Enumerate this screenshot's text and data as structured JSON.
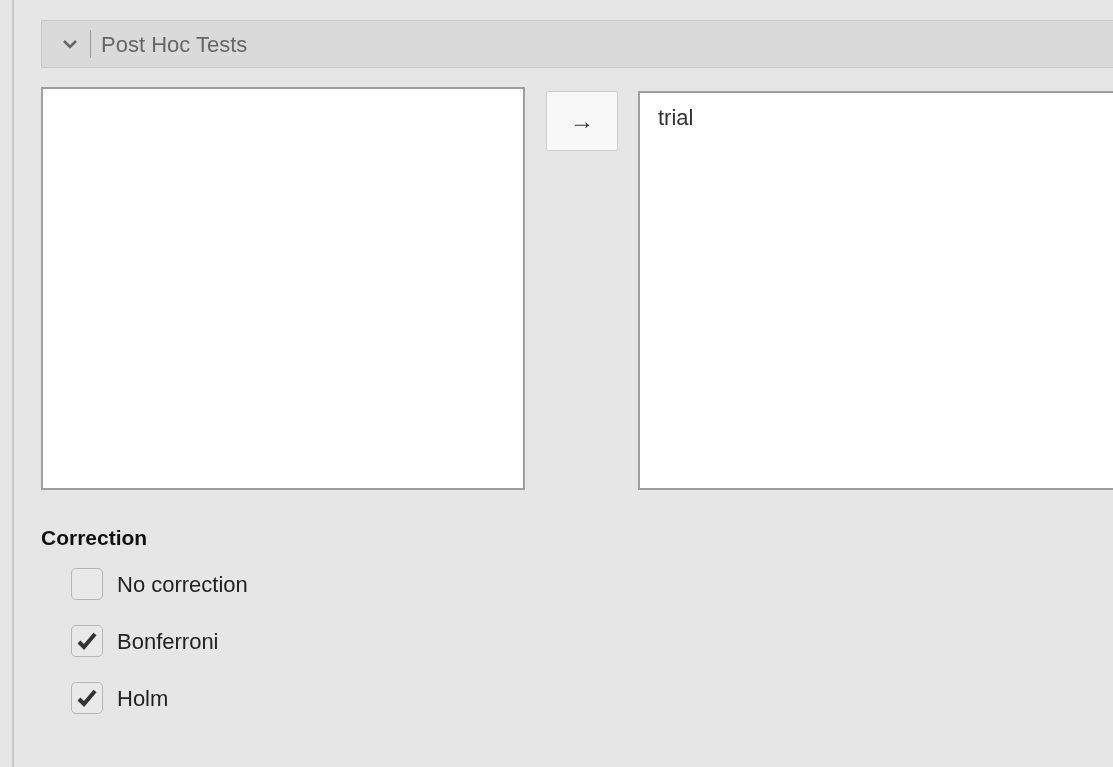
{
  "section": {
    "title": "Post Hoc Tests",
    "expanded": true
  },
  "move_button": {
    "label": "→"
  },
  "selected_list": {
    "items": [
      "trial"
    ]
  },
  "correction": {
    "label": "Correction",
    "options": [
      {
        "label": "No correction",
        "checked": false
      },
      {
        "label": "Bonferroni",
        "checked": true
      },
      {
        "label": "Holm",
        "checked": true
      }
    ]
  }
}
